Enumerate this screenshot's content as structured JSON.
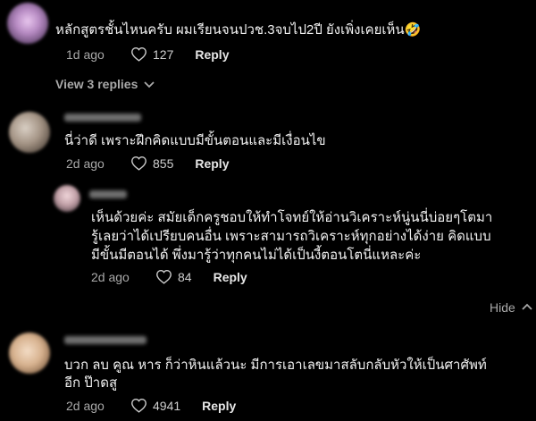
{
  "comments": [
    {
      "text_lines": [
        "หลักสูตรชั้นไหนครับ ผมเรียนจนปวช.3จบไป2ปี ยังเพิ่งเคยเห็น🤣"
      ],
      "age": "1d ago",
      "likes": "127",
      "reply_label": "Reply"
    },
    {
      "text_lines": [
        "นี่ว่าดี เพราะฝึกคิดแบบมีขั้นตอนและมีเงื่อนไข"
      ],
      "age": "2d ago",
      "likes": "855",
      "reply_label": "Reply"
    },
    {
      "text_lines": [
        "เห็นด้วยค่ะ สมัยเด็กครูชอบให้ทำโจทย์ให้อ่านวิเคราะห์นู่นนี่บ่อยๆโตมา",
        "รู้เลยว่าได้เปรียบคนอื่น เพราะสามารถวิเคราะห์ทุกอย่างได้ง่าย คิดแบบ",
        "มีขั้นมีตอนได้ พึ่งมารู้ว่าทุกคนไม่ได้เป็นงี้ตอนโตนี่แหละค่ะ"
      ],
      "age": "2d ago",
      "likes": "84",
      "reply_label": "Reply"
    },
    {
      "text_lines": [
        "บวก ลบ คูณ หาร ก็ว่าหินแล้วนะ มีการเอาเลขมาสลับกลับหัวให้เป็นศาศัพท์",
        "อีก ป๊าดสู"
      ],
      "age": "2d ago",
      "likes": "4941",
      "reply_label": "Reply"
    }
  ],
  "view_replies_label": "View 3 replies",
  "hide_label": "Hide",
  "icons": {
    "heart": "heart-outline-icon",
    "chevron_down": "chevron-down-icon",
    "chevron_up": "chevron-up-icon"
  },
  "colors": {
    "background": "#000000",
    "text": "#f2f2f2",
    "muted": "#a9a9a9"
  }
}
